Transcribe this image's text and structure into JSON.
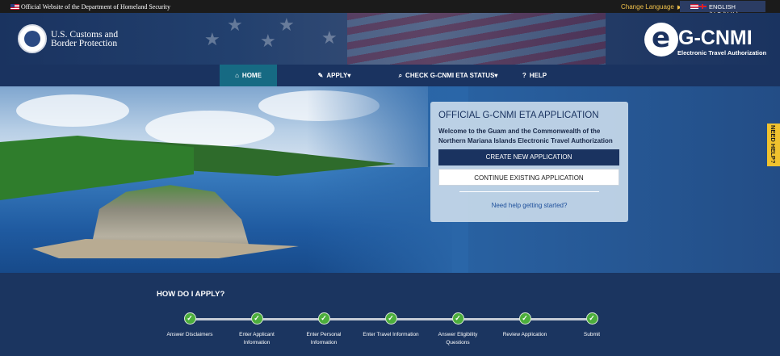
{
  "gov_banner": {
    "official_text": "Official Website of the Department of Homeland Security",
    "change_language": "Change Language",
    "language_selected": "ENGLISH (U.S./U.K.)"
  },
  "header": {
    "agency_line1": "U.S. Customs and",
    "agency_line2": "Border Protection",
    "brand_title": "G-CNMI",
    "brand_subtitle": "Electronic Travel Authorization"
  },
  "nav": {
    "items": [
      {
        "label": "HOME",
        "icon": "home-icon",
        "active": true
      },
      {
        "label": "APPLY",
        "icon": "pencil-icon",
        "dropdown": true
      },
      {
        "label": "CHECK G-CNMI ETA STATUS",
        "icon": "search-icon",
        "dropdown": true
      },
      {
        "label": "HELP",
        "icon": "question-circle-icon"
      }
    ]
  },
  "side_tab": {
    "label": "NEED HELP?"
  },
  "application_card": {
    "title": "OFFICIAL G-CNMI ETA APPLICATION",
    "welcome": "Welcome to the Guam and the Commonwealth of the Northern Mariana Islands Electronic Travel Authorization",
    "create_button": "CREATE NEW APPLICATION",
    "continue_button": "CONTINUE EXISTING APPLICATION",
    "help_link": "Need help getting started?"
  },
  "how_to_apply": {
    "title": "HOW DO I APPLY?",
    "steps": [
      {
        "label": "Answer Disclaimers"
      },
      {
        "label": "Enter Applicant Information"
      },
      {
        "label": "Enter Personal Information"
      },
      {
        "label": "Enter Travel Information"
      },
      {
        "label": "Answer Eligibility Questions"
      },
      {
        "label": "Review Application"
      },
      {
        "label": "Submit"
      }
    ]
  },
  "colors": {
    "navy": "#1a3360",
    "active_tab": "#166a83",
    "help_yellow": "#f0c22e",
    "step_green": "#4cae3c"
  }
}
